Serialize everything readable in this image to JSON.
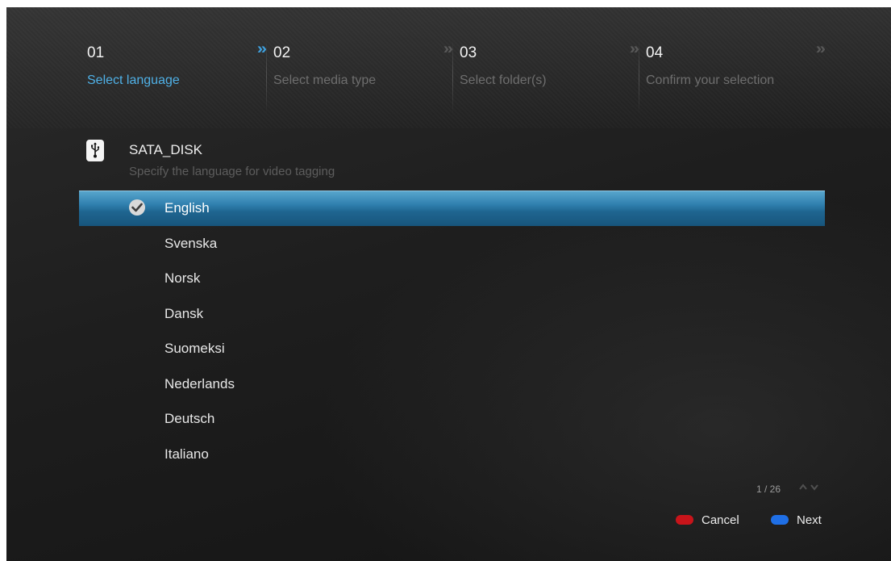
{
  "steps": [
    {
      "number": "01",
      "label": "Select language",
      "active": true
    },
    {
      "number": "02",
      "label": "Select media type",
      "active": false
    },
    {
      "number": "03",
      "label": "Select folder(s)",
      "active": false
    },
    {
      "number": "04",
      "label": "Confirm your selection",
      "active": false
    }
  ],
  "step_arrow_glyph": "»",
  "device": {
    "icon": "usb-icon",
    "name": "SATA_DISK",
    "subtitle": "Specify the language for video tagging"
  },
  "languages": [
    {
      "label": "English",
      "selected": true
    },
    {
      "label": "Svenska",
      "selected": false
    },
    {
      "label": "Norsk",
      "selected": false
    },
    {
      "label": "Dansk",
      "selected": false
    },
    {
      "label": "Suomeksi",
      "selected": false
    },
    {
      "label": "Nederlands",
      "selected": false
    },
    {
      "label": "Deutsch",
      "selected": false
    },
    {
      "label": "Italiano",
      "selected": false
    }
  ],
  "pager": {
    "text": "1 / 26",
    "arrows": "⌃⌄"
  },
  "buttons": {
    "cancel": {
      "label": "Cancel",
      "color": "#c8141a"
    },
    "next": {
      "label": "Next",
      "color": "#1f6fe6"
    }
  },
  "colors": {
    "accent": "#4fb0e6",
    "selection": "#2f7fae"
  }
}
